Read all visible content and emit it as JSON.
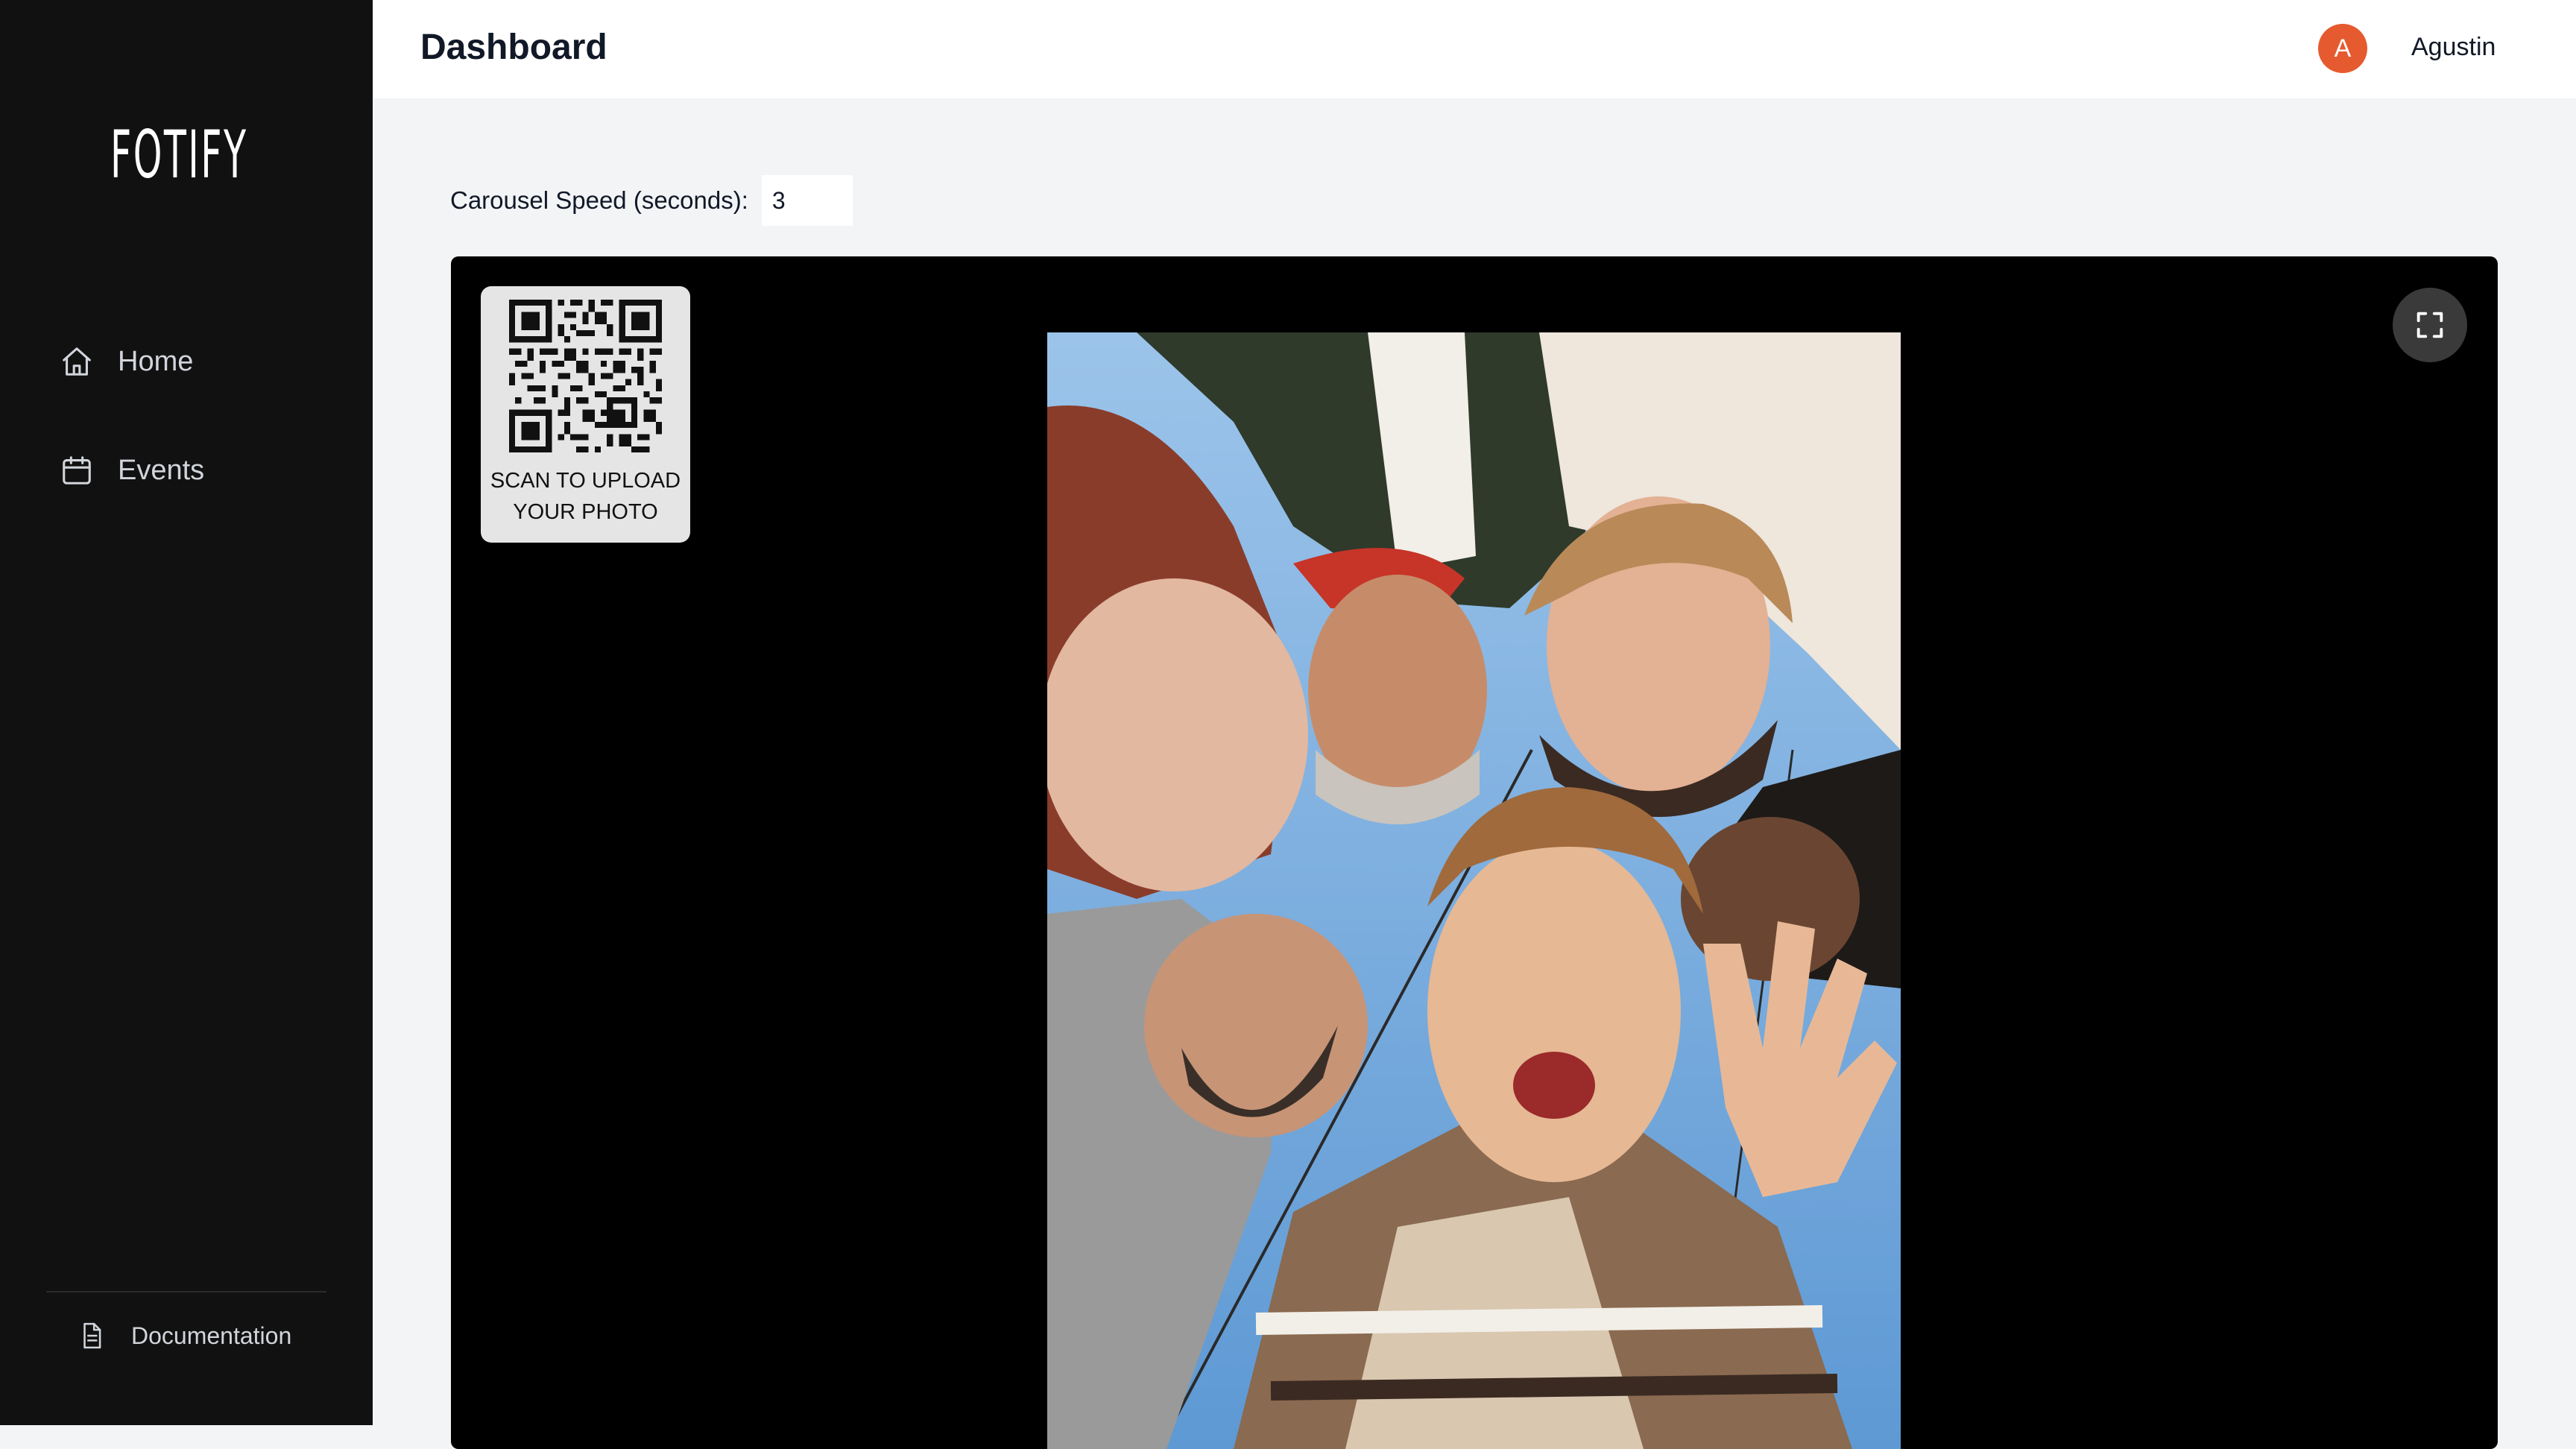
{
  "app": {
    "brand": "FOTIFY"
  },
  "sidebar": {
    "items": [
      {
        "label": "Home",
        "icon": "home-icon"
      },
      {
        "label": "Events",
        "icon": "calendar-icon"
      }
    ],
    "footer": {
      "label": "Documentation",
      "icon": "document-icon"
    }
  },
  "header": {
    "title": "Dashboard",
    "user": {
      "initial": "A",
      "name": "Agustin"
    }
  },
  "controls": {
    "speed_label": "Carousel Speed (seconds):",
    "speed_value": "3"
  },
  "carousel": {
    "qr_caption_line1": "SCAN TO UPLOAD",
    "qr_caption_line2": "YOUR PHOTO",
    "fullscreen_icon": "fullscreen-icon",
    "photo_icon": "group-selfie-photo"
  },
  "colors": {
    "sidebar_bg": "#111111",
    "page_bg": "#f3f4f6",
    "avatar_bg": "#e65a2f",
    "carousel_bg": "#000000"
  }
}
